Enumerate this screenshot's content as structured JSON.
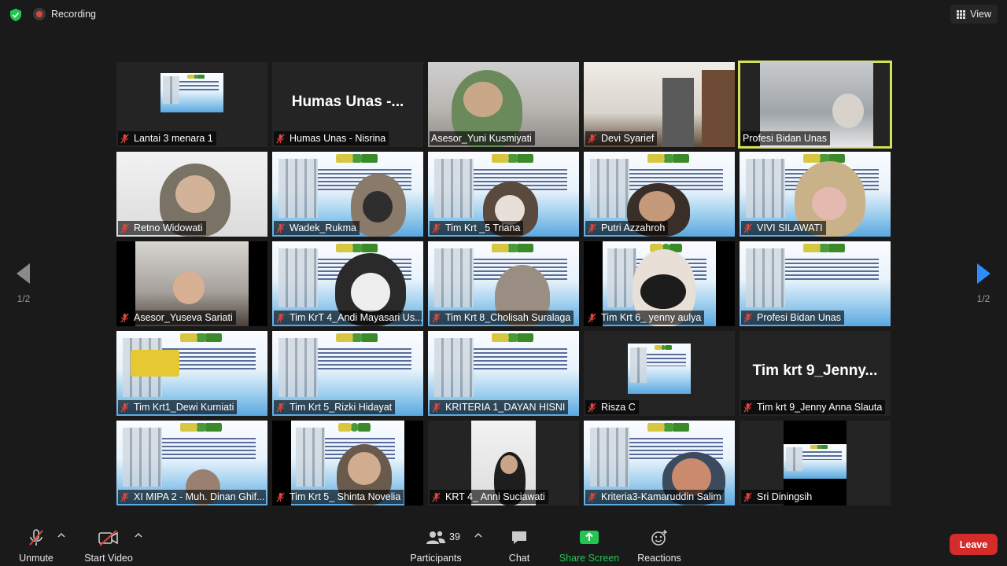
{
  "window": {
    "recording_label": "Recording",
    "view_label": "View"
  },
  "navigation": {
    "left_page": "1/2",
    "right_page": "1/2"
  },
  "participants_tiles": [
    {
      "name": "Lantai 3 menara 1",
      "muted": true
    },
    {
      "name": "Humas Unas - Nisrina",
      "muted": true,
      "display_text": "Humas Unas -..."
    },
    {
      "name": "Asesor_Yuni Kusmiyati",
      "muted": false
    },
    {
      "name": "Devi Syarief",
      "muted": true
    },
    {
      "name": "Profesi Bidan Unas",
      "muted": false,
      "active_speaker": true
    },
    {
      "name": "Retno Widowati",
      "muted": true
    },
    {
      "name": "Wadek_Rukma",
      "muted": true
    },
    {
      "name": "Tim Krt _5 Triana",
      "muted": true
    },
    {
      "name": "Putri Azzahroh",
      "muted": true
    },
    {
      "name": "VIVI SILAWATI",
      "muted": true
    },
    {
      "name": "Asesor_Yuseva Sariati",
      "muted": true
    },
    {
      "name": "Tim KrT 4_Andi Mayasari Us...",
      "muted": true
    },
    {
      "name": "Tim Krt 8_Cholisah Suralaga",
      "muted": true
    },
    {
      "name": "Tim Krt 6_ yenny aulya",
      "muted": true
    },
    {
      "name": "Profesi Bidan Unas",
      "muted": true
    },
    {
      "name": "Tim Krt1_Dewi Kurniati",
      "muted": true
    },
    {
      "name": "Tim Krt 5_Rizki Hidayat",
      "muted": true
    },
    {
      "name": "KRITERIA 1_DAYAN HISNI",
      "muted": true
    },
    {
      "name": "Risza C",
      "muted": true
    },
    {
      "name": "Tim krt 9_Jenny Anna Slauta",
      "muted": true,
      "display_text": "Tim krt 9_Jenny..."
    },
    {
      "name": "XI MIPA 2 - Muh. Dinan Ghif...",
      "muted": true
    },
    {
      "name": "Tim Krt 5_ Shinta Novelia",
      "muted": true
    },
    {
      "name": "KRT 4_ Anni Suciawati",
      "muted": true
    },
    {
      "name": "Kriteria3-Kamaruddin Salim",
      "muted": true
    },
    {
      "name": "Sri Diningsih",
      "muted": true
    }
  ],
  "toolbar": {
    "unmute_label": "Unmute",
    "start_video_label": "Start Video",
    "participants_label": "Participants",
    "participants_count": "39",
    "chat_label": "Chat",
    "share_screen_label": "Share Screen",
    "reactions_label": "Reactions",
    "leave_label": "Leave"
  },
  "colors": {
    "background": "#1a1a1a",
    "active_speaker_border": "#d4e157",
    "share_screen_green": "#23c552",
    "leave_red": "#d42b2b",
    "muted_icon_red": "#e0453d",
    "security_green": "#23c552"
  }
}
